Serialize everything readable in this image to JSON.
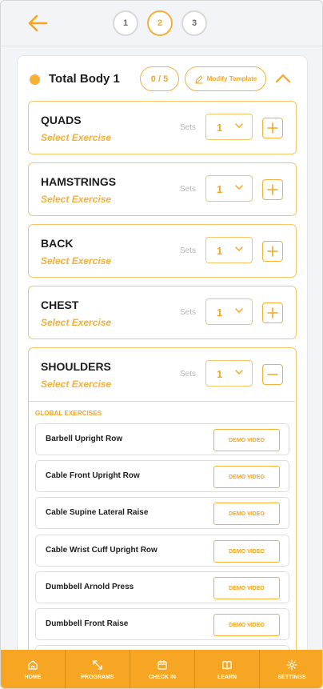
{
  "header": {
    "steps": [
      "1",
      "2",
      "3"
    ],
    "active_step": "2"
  },
  "routine": {
    "title": "Total Body 1",
    "progress": "0 / 5",
    "modify_label": "Modify Template"
  },
  "groups": [
    {
      "name": "QUADS",
      "select_label": "Select Exercise",
      "sets_label": "Sets",
      "sets_value": "1"
    },
    {
      "name": "HAMSTRINGS",
      "select_label": "Select Exercise",
      "sets_label": "Sets",
      "sets_value": "1"
    },
    {
      "name": "BACK",
      "select_label": "Select Exercise",
      "sets_label": "Sets",
      "sets_value": "1"
    },
    {
      "name": "CHEST",
      "select_label": "Select Exercise",
      "sets_label": "Sets",
      "sets_value": "1"
    },
    {
      "name": "SHOULDERS",
      "select_label": "Select Exercise",
      "sets_label": "Sets",
      "sets_value": "1"
    }
  ],
  "exercise_list": {
    "section_label": "GLOBAL EXERCISES",
    "demo_label": "DEMO VIDEO",
    "items": [
      "Barbell Upright Row",
      "Cable Front Upright Row",
      "Cable Supine Lateral Raise",
      "Cable Wrist Cuff Upright Row",
      "Dumbbell Arnold Press",
      "Dumbbell Front Raise"
    ]
  },
  "nav": {
    "items": [
      {
        "label": "HOME",
        "icon": "home-icon"
      },
      {
        "label": "PROGRAMS",
        "icon": "expand-arrows-icon"
      },
      {
        "label": "CHECK IN",
        "icon": "calendar-icon"
      },
      {
        "label": "LEARN",
        "icon": "book-icon"
      },
      {
        "label": "SETTINGS",
        "icon": "gear-icon"
      }
    ]
  },
  "colors": {
    "accent": "#f6a623",
    "border_light": "#f8c66b",
    "background": "#f3f4f7"
  }
}
